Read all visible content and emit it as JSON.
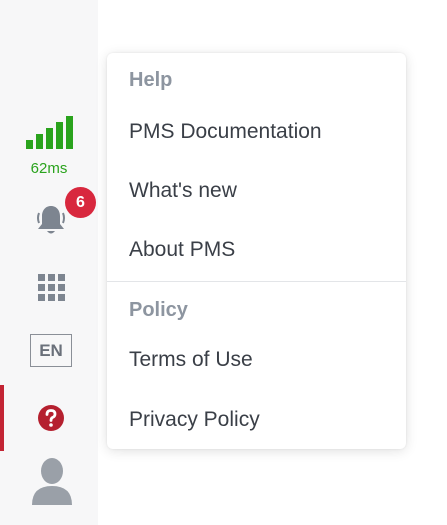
{
  "sidebar": {
    "latency": "62ms",
    "signal_color": "#2aa31d",
    "notifications": {
      "icon": "bell-icon",
      "count": "6"
    },
    "apps_icon": "grid-icon",
    "language": "EN",
    "help_icon": "question-circle-icon",
    "avatar_icon": "user-avatar-icon",
    "active_color": "#c32434"
  },
  "menu": {
    "help_section": {
      "title": "Help",
      "items": [
        "PMS Documentation",
        "What's new",
        "About PMS"
      ]
    },
    "policy_section": {
      "title": "Policy",
      "items": [
        "Terms of Use",
        "Privacy Policy"
      ]
    }
  }
}
